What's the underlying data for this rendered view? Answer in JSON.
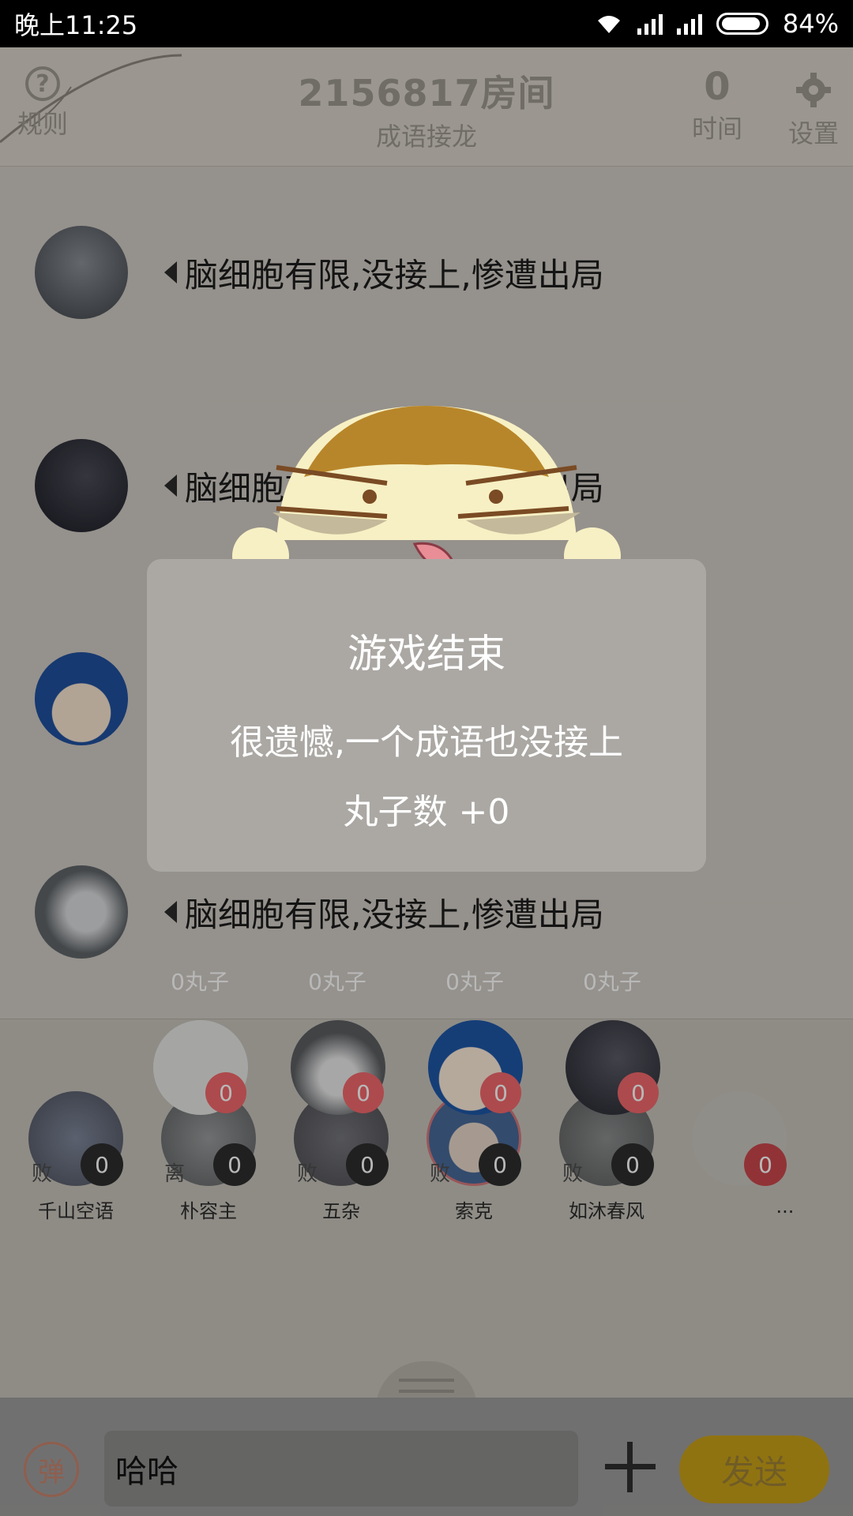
{
  "status_bar": {
    "time": "晚上11:25",
    "battery": "84%"
  },
  "header": {
    "rule_label": "规则",
    "help_glyph": "?",
    "room_title": "2156817房间",
    "mode": "成语接龙",
    "time_value": "0",
    "time_label": "时间",
    "settings_label": "设置"
  },
  "messages": [
    {
      "text": "脑细胞有限,没接上,惨遭出局"
    },
    {
      "text": "脑细胞有限,没接上,惨遭出局"
    },
    {
      "text": ""
    },
    {
      "text": "脑细胞有限,没接上,惨遭出局"
    }
  ],
  "points": [
    "0丸子",
    "0丸子",
    "0丸子",
    "0丸子"
  ],
  "top_badges": [
    "0",
    "0",
    "0",
    "0"
  ],
  "players": [
    {
      "name": "千山空语",
      "status": "败",
      "score": "0"
    },
    {
      "name": "朴容主",
      "status": "离",
      "score": "0"
    },
    {
      "name": "五杂",
      "status": "败",
      "score": "0"
    },
    {
      "name": "索克",
      "status": "败",
      "score": "0"
    },
    {
      "name": "如沐春风",
      "status": "败",
      "score": "0"
    },
    {
      "name": "...",
      "status": "",
      "score": "0"
    }
  ],
  "input": {
    "dan_label": "弹",
    "value": "哈哈",
    "send_label": "发送"
  },
  "modal": {
    "title": "游戏结束",
    "message": "很遗憾,一个成语也没接上",
    "score": "丸子数 +0"
  },
  "colors": {
    "badge_red": "#f0676b",
    "send_yellow": "#c8a018",
    "modal_bg": "#aba8a4"
  }
}
